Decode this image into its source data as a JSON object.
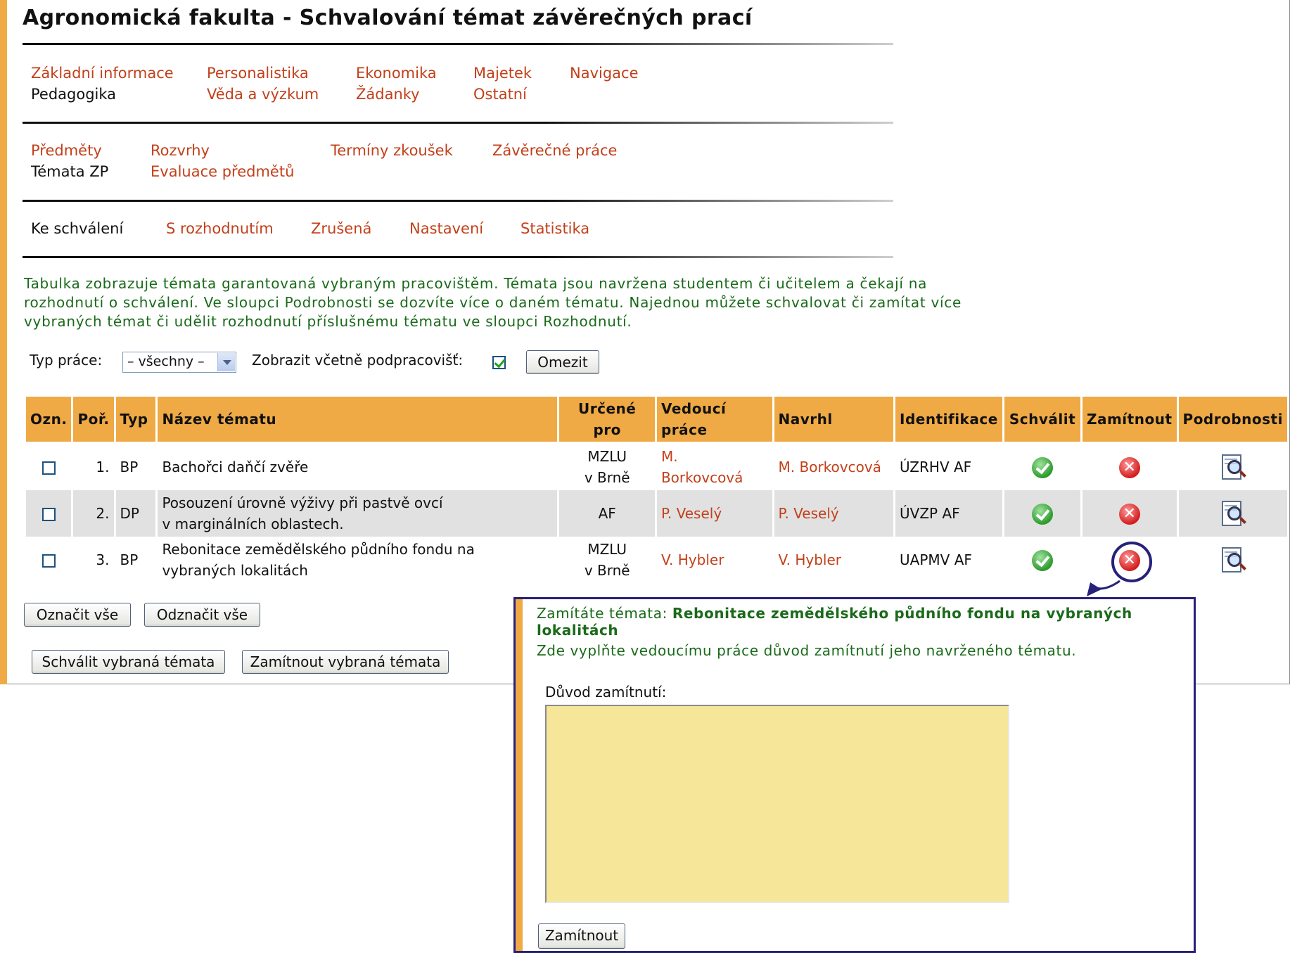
{
  "title": "Agronomická fakulta - Schvalování témat závěrečných prací",
  "nav1": [
    {
      "label": "Základní informace"
    },
    {
      "label": "Pedagogika"
    },
    {
      "label": "Personalistika"
    },
    {
      "label": "Věda a výzkum"
    },
    {
      "label": "Ekonomika"
    },
    {
      "label": "Žádanky"
    },
    {
      "label": "Majetek"
    },
    {
      "label": "Ostatní"
    },
    {
      "label": "Navigace"
    }
  ],
  "nav2": [
    {
      "label": "Předměty"
    },
    {
      "label": "Témata ZP"
    },
    {
      "label": "Rozvrhy"
    },
    {
      "label": "Evaluace předmětů"
    },
    {
      "label": "Termíny zkoušek"
    },
    {
      "label": "Závěrečné práce"
    }
  ],
  "nav3": [
    {
      "label": "Ke schválení"
    },
    {
      "label": "S rozhodnutím"
    },
    {
      "label": "Zrušená"
    },
    {
      "label": "Nastavení"
    },
    {
      "label": "Statistika"
    }
  ],
  "intro": "Tabulka zobrazuje témata garantovaná vybraným pracovištěm. Témata jsou navržena studentem či učitelem a čekají na rozhodnutí o schválení. Ve sloupci Podrobnosti se dozvíte více o daném tématu. Najednou můžete schvalovat či zamítat více vybraných témat či udělit rozhodnutí příslušnému tématu ve sloupci Rozhodnutí.",
  "filter": {
    "type_label": "Typ práce:",
    "type_value": "– všechny –",
    "include_label": "Zobrazit včetně podpracovišť:",
    "include_checked": true,
    "submit": "Omezit"
  },
  "table": {
    "headers": {
      "mark": "Ozn.",
      "order": "Poř.",
      "type": "Typ",
      "name": "Název tématu",
      "for_1": "Určené",
      "for_2": "pro",
      "supervisor_1": "Vedoucí",
      "supervisor_2": "práce",
      "proposed": "Navrhl",
      "ident": "Identifikace",
      "approve": "Schválit",
      "reject": "Zamítnout",
      "details": "Podrobnosti"
    },
    "rows": [
      {
        "order": "1.",
        "type": "BP",
        "name": "Bachořci daňčí zvěře",
        "name2": "",
        "for1": "MZLU",
        "for2": "v Brně",
        "supervisor": "M.",
        "supervisor2": "Borkovcová",
        "proposed": "M. Borkovcová",
        "ident": "ÚZRHV AF"
      },
      {
        "order": "2.",
        "type": "DP",
        "name": "Posouzení úrovně výživy při pastvě ovcí",
        "name2": "v marginálních oblastech.",
        "for1": "AF",
        "for2": "",
        "supervisor": "P. Veselý",
        "supervisor2": "",
        "proposed": "P. Veselý",
        "ident": "ÚVZP AF"
      },
      {
        "order": "3.",
        "type": "BP",
        "name": "Rebonitace zemědělského půdního fondu na",
        "name2": "vybraných lokalitách",
        "for1": "MZLU",
        "for2": "v Brně",
        "supervisor": "V. Hybler",
        "supervisor2": "",
        "proposed": "V. Hybler",
        "ident": "UAPMV AF"
      }
    ]
  },
  "buttons": {
    "select_all": "Označit vše",
    "deselect_all": "Odznačit vše",
    "approve_selected": "Schválit vybraná témata",
    "reject_selected": "Zamítnout vybraná témata"
  },
  "popup": {
    "lead": "Zamítáte témata:",
    "topic": "Rebonitace zemědělského půdního fondu na vybraných lokalitách",
    "instruction": "Zde vyplňte vedoucímu práce důvod zamítnutí jeho navrženého tématu.",
    "reason_label": "Důvod zamítnutí:",
    "reason_value": "",
    "submit": "Zamítnout"
  },
  "colors": {
    "accent": "#efaa45",
    "link": "#c2401a",
    "intro_text": "#1a6a1a",
    "callout": "#27217a",
    "textarea_bg": "#f5e699"
  }
}
